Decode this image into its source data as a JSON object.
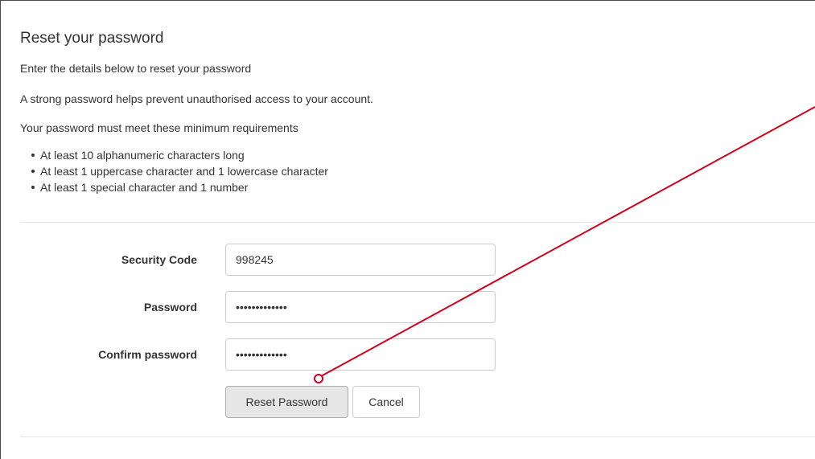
{
  "page": {
    "title": "Reset your password",
    "intro": "Enter the details below to reset your password",
    "strength_note": "A strong password helps prevent unauthorised access to your account.",
    "requirements_heading": "Your password must meet these minimum requirements",
    "requirements": [
      "At least 10 alphanumeric characters long",
      "At least 1 uppercase character and 1 lowercase character",
      "At least 1 special character and 1 number"
    ]
  },
  "form": {
    "security_code": {
      "label": "Security Code",
      "value": "998245"
    },
    "password": {
      "label": "Password",
      "value": "•••••••••••••"
    },
    "confirm_password": {
      "label": "Confirm password",
      "value": "•••••••••••••"
    },
    "reset_label": "Reset Password",
    "cancel_label": "Cancel"
  },
  "colors": {
    "annotation": "#d0021b",
    "text": "#333333",
    "input_border": "#cccccc",
    "reset_bg": "#e6e6e6"
  },
  "annotation": {
    "icon": "pointer-line-with-circle"
  }
}
